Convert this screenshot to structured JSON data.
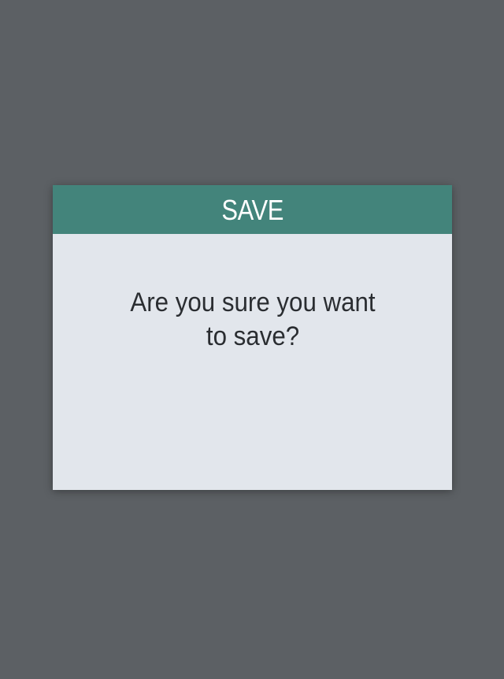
{
  "dialog": {
    "title": "SAVE",
    "message": "Are you sure you want to save?"
  },
  "colors": {
    "backdrop": "#5c6064",
    "header": "#43847b",
    "body": "#e2e6ec",
    "title_text": "#ffffff",
    "message_text": "#2a2d31"
  }
}
